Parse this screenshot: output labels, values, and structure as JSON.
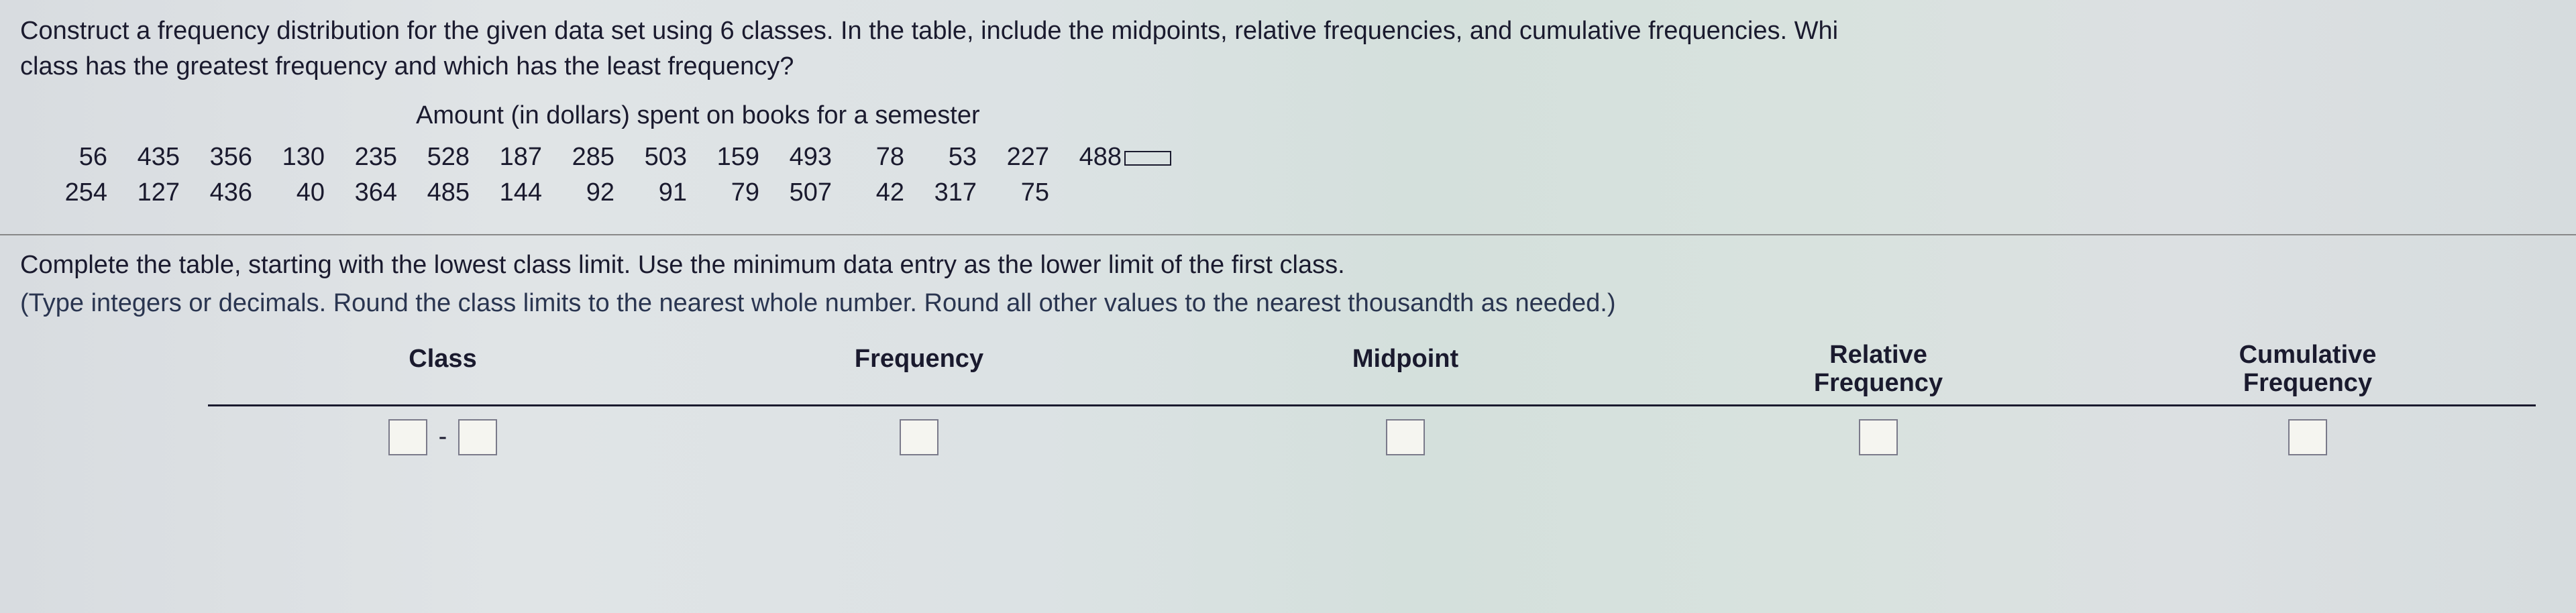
{
  "question": {
    "line1": "Construct a frequency distribution for the given data set using 6 classes. In the table, include the midpoints, relative frequencies, and cumulative frequencies. Whi",
    "line2": "class has the greatest frequency and which has the least frequency?"
  },
  "data_title": "Amount (in dollars) spent on books for a semester",
  "data_row1": [
    "56",
    "435",
    "356",
    "130",
    "235",
    "528",
    "187",
    "285",
    "503",
    "159",
    "493",
    "78",
    "53",
    "227",
    "488"
  ],
  "data_row2": [
    "254",
    "127",
    "436",
    "40",
    "364",
    "485",
    "144",
    "92",
    "91",
    "79",
    "507",
    "42",
    "317",
    "75"
  ],
  "instructions": "Complete the table, starting with the lowest class limit. Use the minimum data entry as the lower limit of the first class.",
  "hint": "(Type integers or decimals. Round the class limits to the nearest whole number. Round all other values to the nearest thousandth as needed.)",
  "headers": {
    "class": "Class",
    "frequency": "Frequency",
    "midpoint": "Midpoint",
    "relative_l1": "Relative",
    "relative_l2": "Frequency",
    "cumulative_l1": "Cumulative",
    "cumulative_l2": "Frequency"
  },
  "dash": "-"
}
